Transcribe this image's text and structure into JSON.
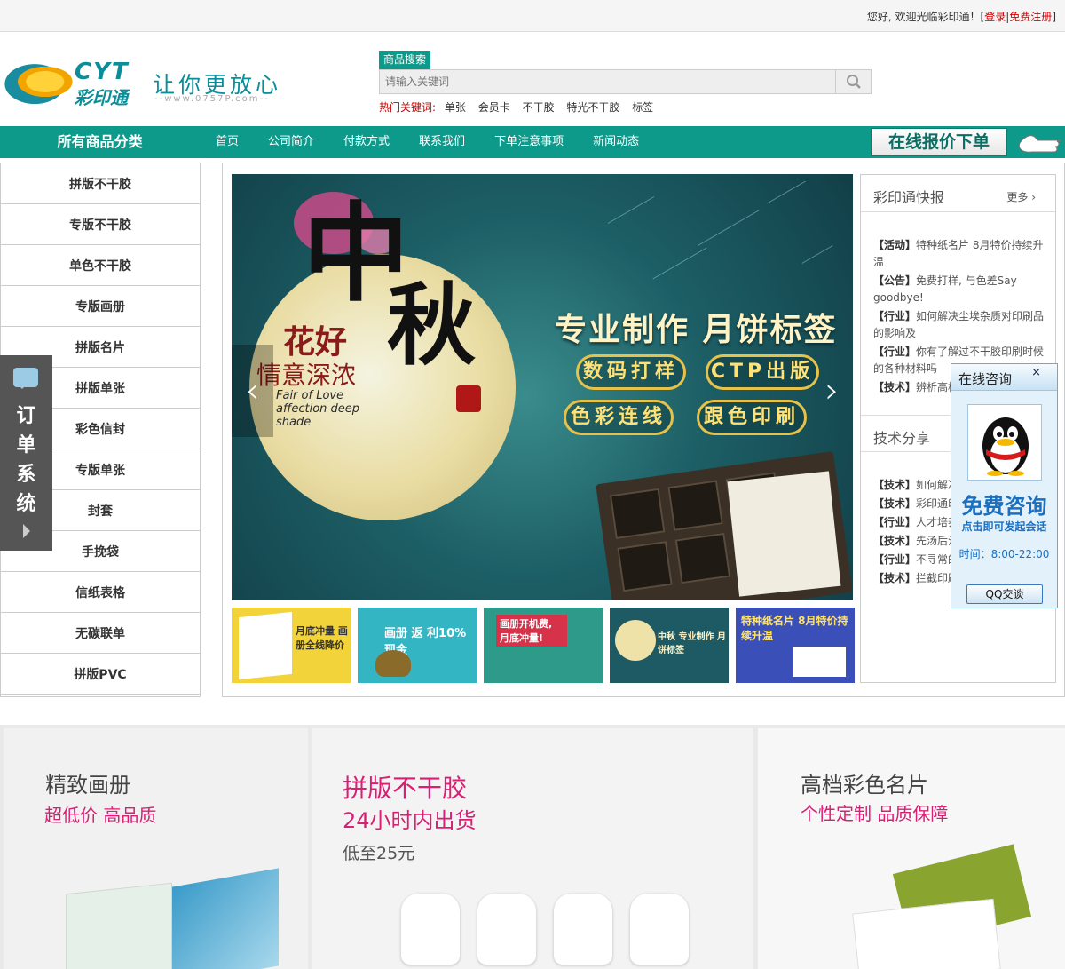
{
  "topbar": {
    "greeting": "您好, 欢迎光临彩印通！",
    "login": "登录",
    "register": "免费注册",
    "sep_open": "[",
    "sep_mid": "|",
    "sep_close": "]"
  },
  "header": {
    "brand": "CYT",
    "brand_cn": "彩印通",
    "slogan": "让你更放心",
    "url": "--www.0757P.com--",
    "search_tab": "商品搜索",
    "search_placeholder": "请输入关键词",
    "hot_label": "热门关键词:",
    "hot_words": [
      "单张",
      "会员卡",
      "不干胶",
      "特光不干胶",
      "标签"
    ]
  },
  "nav": {
    "all_categories": "所有商品分类",
    "links": [
      "首页",
      "公司简介",
      "付款方式",
      "联系我们",
      "下单注意事项",
      "新闻动态"
    ],
    "quote_button": "在线报价下单"
  },
  "categories": [
    "拼版不干胶",
    "专版不干胶",
    "单色不干胶",
    "专版画册",
    "拼版名片",
    "拼版单张",
    "彩色信封",
    "专版单张",
    "封套",
    "手挽袋",
    "信纸表格",
    "无碳联单",
    "拼版PVC"
  ],
  "order_system": {
    "label": [
      "订",
      "单",
      "系",
      "统"
    ]
  },
  "banner": {
    "calligraphy_1": "中",
    "calligraphy_2": "秋",
    "flower_text": "花好",
    "flower_text2": "情意深浓",
    "english": "Fair of Love affection deep shade",
    "headline": "专业制作 月饼标签",
    "pills": [
      "数码打样",
      "CTP出版",
      "色彩连线",
      "跟色印刷"
    ],
    "prev": "‹",
    "next": "›"
  },
  "thumbnails": [
    {
      "text": "月底冲量 画册全线降价",
      "bg": "#f2d33a"
    },
    {
      "text": "画册 返 利10%现金",
      "bg": "#34b5c3"
    },
    {
      "text": "画册开机费, 月底冲量!",
      "bg": "#2d9a8a"
    },
    {
      "text": "中秋 专业制作 月饼标签",
      "bg": "#1d5a63"
    },
    {
      "text": "特种纸名片 8月特价持续升温",
      "bg": "#3b4fb8"
    }
  ],
  "news": {
    "title": "彩印通快报",
    "more": "更多",
    "items": [
      {
        "tag": "【活动】",
        "text": "特种纸名片 8月特价持续升温"
      },
      {
        "tag": "【公告】",
        "text": "免费打样, 与色差Say goodbye!"
      },
      {
        "tag": "【行业】",
        "text": "如何解决尘埃杂质对印刷品的影响及"
      },
      {
        "tag": "【行业】",
        "text": "你有了解过不干胶印刷时候的各种材料吗"
      },
      {
        "tag": "【技术】",
        "text": "辨析高档印刷的区别"
      }
    ],
    "title2": "技术分享",
    "items2": [
      {
        "tag": "【技术】",
        "text": "如何解决问题"
      },
      {
        "tag": "【技术】",
        "text": "彩印通印刷需要注意哪些"
      },
      {
        "tag": "【行业】",
        "text": "人才培养的重要性"
      },
      {
        "tag": "【技术】",
        "text": "先汤后注意的问题"
      },
      {
        "tag": "【行业】",
        "text": "不寻常的展览"
      },
      {
        "tag": "【技术】",
        "text": "拦截印刷订单"
      }
    ]
  },
  "consult": {
    "title": "在线咨询",
    "close": "×",
    "free": "免费咨询",
    "click": "点击即可发起会话",
    "time": "时间：8:00-22:00",
    "button": "QQ交谈"
  },
  "promos": [
    {
      "title": "精致画册",
      "sub": "超低价 高品质",
      "price": ""
    },
    {
      "title": "拼版不干胶",
      "sub": "24小时内出货",
      "price": "低至25元"
    },
    {
      "title": "高档彩色名片",
      "sub": "个性定制 品质保障",
      "price": ""
    }
  ],
  "colors": {
    "brand": "#0e9a8a",
    "accent_red": "#d40000",
    "promo_pink": "#d81f73"
  }
}
